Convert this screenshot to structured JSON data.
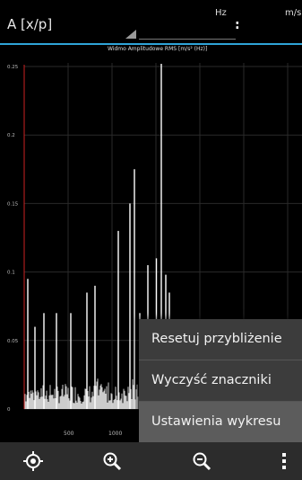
{
  "header": {
    "title": "A [x/p]",
    "unit_hz": "Hz",
    "unit_ms": "m/s"
  },
  "chart_data": {
    "type": "line",
    "title": "Widmo Amplitudowe RMS [m/s² (Hz)]",
    "ylim": [
      0,
      0.25
    ],
    "y_ticks": [
      "0.25",
      "0.2",
      "0.15",
      "0.1",
      "0.05",
      "0"
    ],
    "x_ticks": [
      "500",
      "1000"
    ],
    "grid": true,
    "peaks": [
      {
        "x": 40,
        "y": 0.095
      },
      {
        "x": 120,
        "y": 0.06
      },
      {
        "x": 220,
        "y": 0.07
      },
      {
        "x": 360,
        "y": 0.07
      },
      {
        "x": 520,
        "y": 0.07
      },
      {
        "x": 700,
        "y": 0.085
      },
      {
        "x": 790,
        "y": 0.09
      },
      {
        "x": 1050,
        "y": 0.13
      },
      {
        "x": 1180,
        "y": 0.15
      },
      {
        "x": 1230,
        "y": 0.175
      },
      {
        "x": 1290,
        "y": 0.07
      },
      {
        "x": 1380,
        "y": 0.105
      },
      {
        "x": 1475,
        "y": 0.11
      },
      {
        "x": 1530,
        "y": 0.252
      },
      {
        "x": 1580,
        "y": 0.098
      },
      {
        "x": 1620,
        "y": 0.085
      }
    ]
  },
  "menu": {
    "items": [
      "Resetuj przybliżenie",
      "Wyczyść znaczniki",
      "Ustawienia wykresu"
    ]
  },
  "toolbar": {
    "icons": [
      "locate-icon",
      "zoom-in-icon",
      "zoom-out-icon",
      "overflow-menu-icon"
    ]
  },
  "colors": {
    "accent": "#2fa4d8",
    "axis": "#cc2222",
    "menu_bg": "#3c3c3c",
    "toolbar_bg": "#2c2c2c"
  }
}
